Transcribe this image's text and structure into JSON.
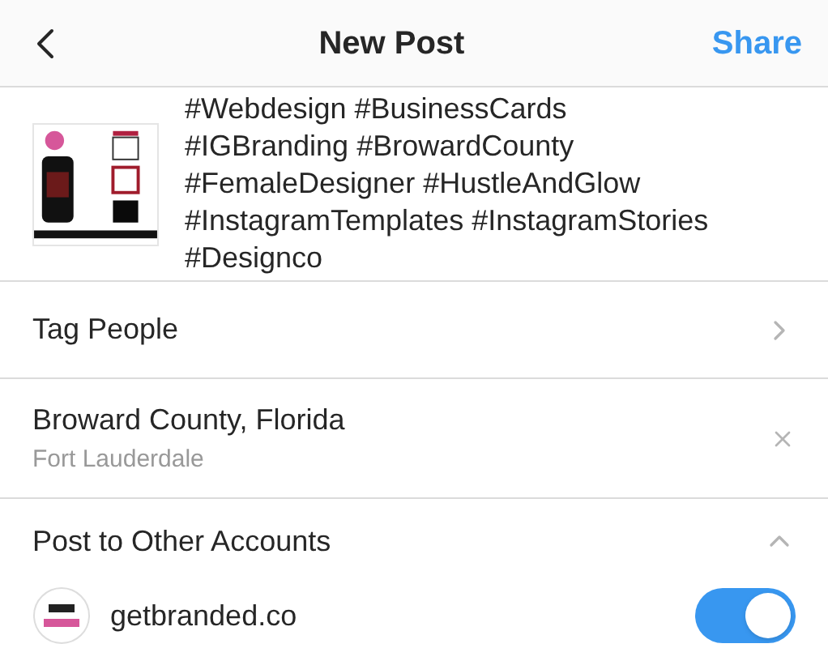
{
  "header": {
    "title": "New Post",
    "action": "Share"
  },
  "caption": {
    "text": "#Webdesign #BusinessCards\n#IGBranding #BrowardCounty\n#FemaleDesigner #HustleAndGlow\n#InstagramTemplates #InstagramStories\n#Designco"
  },
  "tag_people": {
    "label": "Tag People"
  },
  "location": {
    "name": "Broward County, Florida",
    "subtitle": "Fort Lauderdale"
  },
  "other_accounts": {
    "title": "Post to Other Accounts",
    "expanded": true,
    "accounts": [
      {
        "name": "getbranded.co",
        "on": true
      }
    ]
  }
}
